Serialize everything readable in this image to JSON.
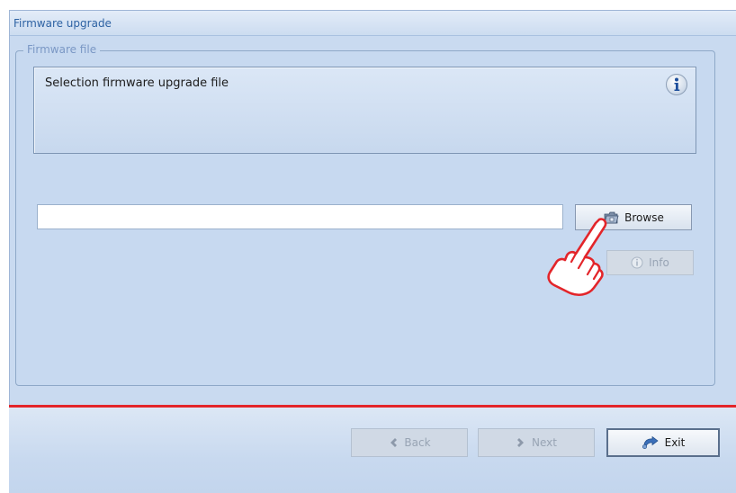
{
  "window": {
    "title": "Firmware upgrade"
  },
  "group": {
    "legend": "Firmware file"
  },
  "info_panel": {
    "text": "Selection firmware upgrade file",
    "icon": "info-icon"
  },
  "file_input": {
    "value": "",
    "placeholder": ""
  },
  "buttons": {
    "browse": {
      "label": "Browse",
      "icon": "folder-icon"
    },
    "info": {
      "label": "Info",
      "icon": "info-circle-icon",
      "disabled": true
    },
    "back": {
      "label": "Back",
      "icon": "chevron-left-icon",
      "disabled": true
    },
    "next": {
      "label": "Next",
      "icon": "chevron-right-icon",
      "disabled": true
    },
    "exit": {
      "label": "Exit",
      "icon": "exit-icon"
    }
  },
  "colors": {
    "accent_line": "#e3252a",
    "title_text": "#2d62a3",
    "legend_text": "#7b98c5",
    "window_bg": "#c9daf0"
  },
  "overlay": {
    "icon": "pointing-hand-icon"
  }
}
